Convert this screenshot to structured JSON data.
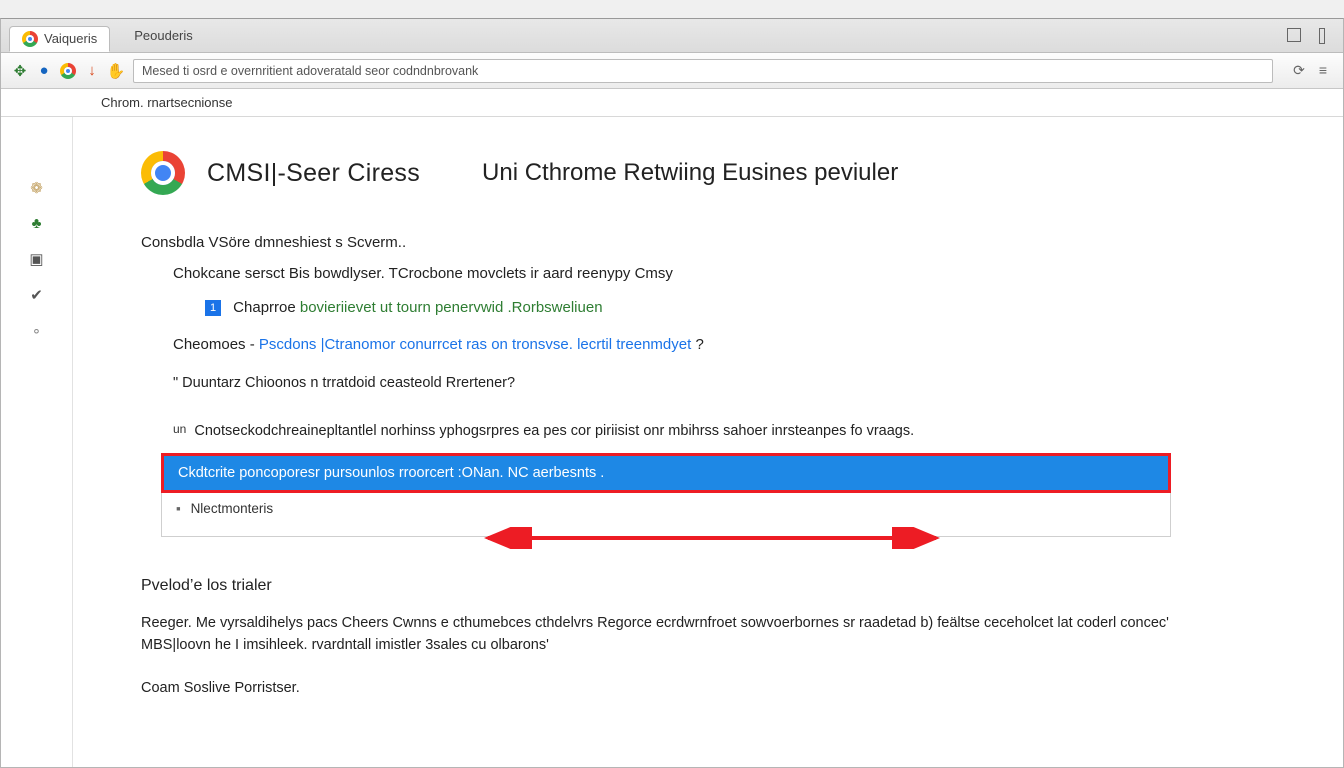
{
  "tabs": {
    "active": {
      "label": "Vaiqueris"
    },
    "inactive": {
      "label": "Peouderis"
    }
  },
  "address_bar": {
    "text": "Mesed ti osrd e overnritient adoveratald seor codndnbrovank"
  },
  "breadcrumb": "Chrom. rnartsecnionse",
  "sidebar_icons": [
    "ribbon-icon",
    "leaf-icon",
    "window-icon",
    "check-icon",
    "dot-icon"
  ],
  "page": {
    "title_left": "CMSI|-Seer Ciress",
    "title_right": "Uni Cthrome Retwiing Eusines peviuler",
    "intro": "Consbdla VSöre dmneshiest s Scverm..",
    "line1": "Chokcane sersct Bis bowdlyser. TCrocbone movclets ir aard reenypy Cmsy",
    "bullet_num": "1",
    "bullet_text_a": "Chaprroe ",
    "bullet_text_b": "bovieriievet ut tourn penervwid .Rorbsweliuen",
    "line2_a": "Cheomoes - ",
    "line2_b": "Pscdons |Ctranomor conurrcet ras on tronsvse. lecrtil treenmdyet",
    "line2_c": " ?",
    "q1": "\" Duuntarz Chioonos n trratdoid ceasteold Rrertener?",
    "para_lead_prefix": "un",
    "para_lead": "Cnotseckodchreainepltantlel norhinss yphogsrpres ea pes cor piriisist onr mbihrss sahoer inrsteanpes fo vraags.",
    "highlight": "Ckdtcrite poncoporesr pursounlos rroorcert :ONan. NC aerbesnts .",
    "sub_row": "Nlectmonteris",
    "section_title": "Pvelod’e los trialer",
    "para2": "Reeger. Me vyrsaldihelys pacs Cheers Cwnns e cthumebces cthdelvrs Regorce ecrdwrnfroet sowvoerbornes sr raadetad b) feältse ceceholcet lat coderl concec' MBS|loovn he I imsihleek. rvardntall imistler 3sales cu olbarons'",
    "footer": "Coam Soslive Porristser."
  }
}
